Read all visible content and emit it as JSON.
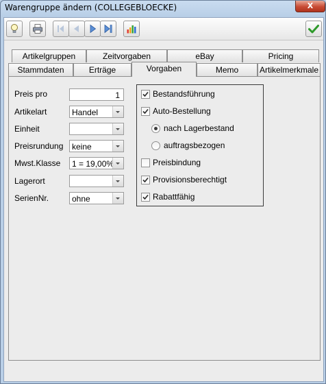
{
  "window": {
    "title": "Warengruppe ändern (COLLEGEBLOECKE)",
    "close_label": "X"
  },
  "toolbar": {
    "buttons": [
      {
        "name": "lightbulb-icon"
      },
      {
        "name": "printer-icon"
      },
      {
        "name": "first-record-icon"
      },
      {
        "name": "previous-record-icon"
      },
      {
        "name": "next-record-icon"
      },
      {
        "name": "last-record-icon"
      },
      {
        "name": "bar-chart-icon"
      },
      {
        "name": "checkmark-icon"
      }
    ]
  },
  "tabs": {
    "back_row": [
      "Artikelgruppen",
      "Zeitvorgaben",
      "eBay",
      "Pricing"
    ],
    "front_row": [
      "Stammdaten",
      "Erträge",
      "Vorgaben",
      "Memo",
      "Artikelmerkmale"
    ],
    "active": "Vorgaben"
  },
  "form": {
    "preis_pro": {
      "label": "Preis pro",
      "value": "1"
    },
    "artikelart": {
      "label": "Artikelart",
      "value": "Handel"
    },
    "einheit": {
      "label": "Einheit",
      "value": ""
    },
    "preisrundung": {
      "label": "Preisrundung",
      "value": "keine"
    },
    "mwst_klasse": {
      "label": "Mwst.Klasse",
      "value": "1 = 19,00%"
    },
    "lagerort": {
      "label": "Lagerort",
      "value": ""
    },
    "seriennr": {
      "label": "SerienNr.",
      "value": "ohne"
    }
  },
  "options": {
    "bestandsfuehrung": {
      "label": "Bestandsführung",
      "checked": true
    },
    "auto_bestellung": {
      "label": "Auto-Bestellung",
      "checked": true
    },
    "nach_lagerbestand": {
      "label": "nach Lagerbestand",
      "selected": true
    },
    "auftragsbezogen": {
      "label": "auftragsbezogen",
      "selected": false
    },
    "preisbindung": {
      "label": "Preisbindung",
      "checked": false
    },
    "provisionsberechtigt": {
      "label": "Provisionsberechtigt",
      "checked": true
    },
    "rabattfaehig": {
      "label": "Rabattfähig",
      "checked": true
    }
  }
}
